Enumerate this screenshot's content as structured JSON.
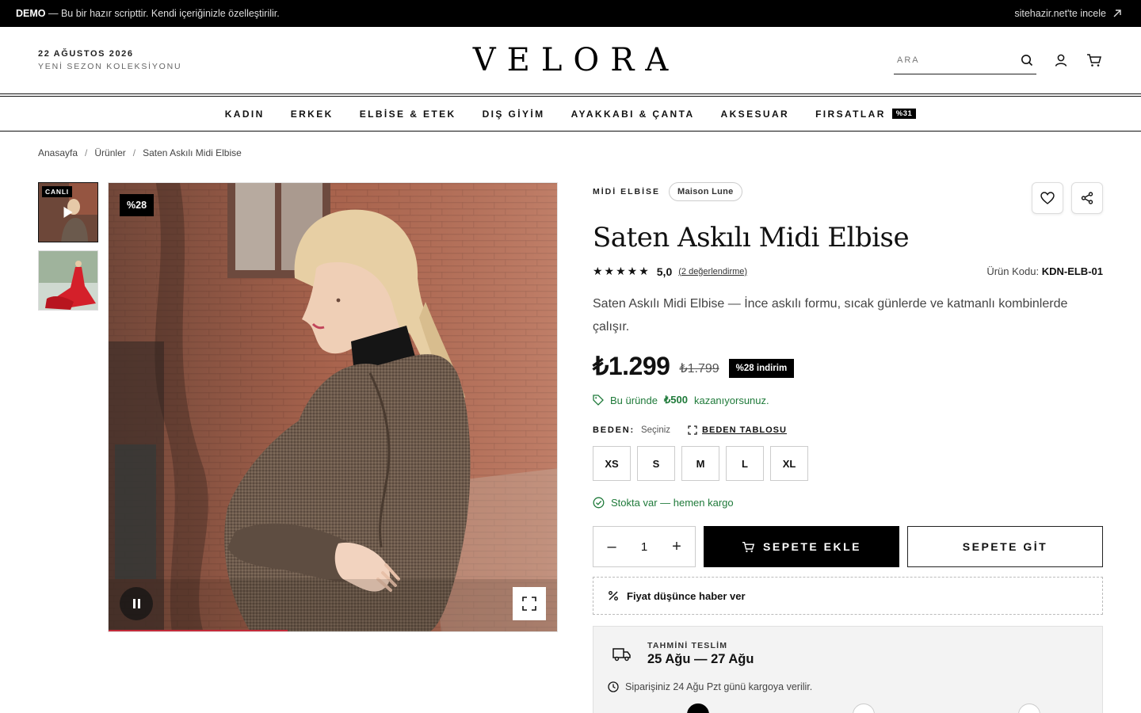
{
  "demo_bar": {
    "tag": "DEMO",
    "text": " — Bu bir hazır scripttir. Kendi içeriğinizle özelleştirilir.",
    "link": "sitehazir.net'te incele"
  },
  "header": {
    "date": "22 AĞUSTOS 2026",
    "season": "YENİ SEZON KOLEKSİYONU",
    "logo": "VELORA",
    "search_placeholder": "ARA"
  },
  "nav": {
    "items": [
      "KADIN",
      "ERKEK",
      "ELBİSE & ETEK",
      "DIŞ GİYİM",
      "AYAKKABI & ÇANTA",
      "AKSESUAR",
      "FIRSATLAR"
    ],
    "deals_badge": "%31"
  },
  "breadcrumb": {
    "items": [
      "Anasayfa",
      "Ürünler",
      "Saten Askılı Midi Elbise"
    ],
    "sep": "/"
  },
  "gallery": {
    "live_label": "CANLI",
    "discount_badge": "%28",
    "video_progress": 0.4
  },
  "product": {
    "category": "MİDİ ELBİSE",
    "brand": "Maison Lune",
    "title": "Saten Askılı Midi Elbise",
    "rating": "5,0",
    "rating_stars": 5,
    "reviews": "(2 değerlendirme)",
    "sku_label": "Ürün Kodu:",
    "sku": "KDN-ELB-01",
    "description": "Saten Askılı Midi Elbise — İnce askılı formu, sıcak günlerde ve katmanlı kombinlerde çalışır.",
    "price": "₺1.299",
    "old_price": "₺1.799",
    "discount_tag": "%28 indirim",
    "savings_pre": "Bu üründe",
    "savings_amount": "₺500",
    "savings_post": "kazanıyorsunuz.",
    "size_label": "BEDEN:",
    "size_choose": "Seçiniz",
    "size_table": "BEDEN TABLOSU",
    "sizes": [
      "XS",
      "S",
      "M",
      "L",
      "XL"
    ],
    "stock": "Stokta var — hemen kargo",
    "quantity": "1",
    "qty_minus": "–",
    "qty_plus": "+",
    "add_to_cart": "SEPETE EKLE",
    "go_to_cart": "SEPETE GİT",
    "price_alert": "Fiyat düşünce haber ver"
  },
  "delivery": {
    "label": "TAHMİNİ TESLİM",
    "dates": "25 Ağu — 27 Ağu",
    "note": "Siparişiniz 24 Ağu Pzt günü kargoya verilir."
  },
  "colors": {
    "accent": "#000000",
    "success": "#1f7a3a",
    "progress": "#c42a3a"
  }
}
